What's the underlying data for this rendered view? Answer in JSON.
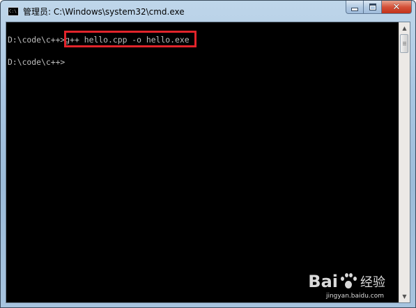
{
  "window": {
    "title": "管理员: C:\\Windows\\system32\\cmd.exe",
    "app_icon_text": "C:\\"
  },
  "caption_buttons": {
    "close_label": "✕"
  },
  "console": {
    "line1_prompt": "D:\\code\\c++>",
    "line1_command": "g++ hello.cpp -o hello.exe",
    "line2_prompt": "D:\\code\\c++>"
  },
  "highlight": {
    "color": "#e2242b"
  },
  "watermark": {
    "brand_left": "Bai",
    "brand_right": "",
    "sub": "经验",
    "url": "jingyan.baidu.com"
  },
  "colors": {
    "console_bg": "#000000",
    "console_fg": "#c0c0c0",
    "titlebar": "#a9c6e2",
    "close_button": "#c2321a"
  },
  "icons": [
    "cmd-app-icon",
    "minimize-icon",
    "maximize-icon",
    "close-icon",
    "scroll-up-icon",
    "scroll-down-icon",
    "baidu-paw-icon"
  ]
}
